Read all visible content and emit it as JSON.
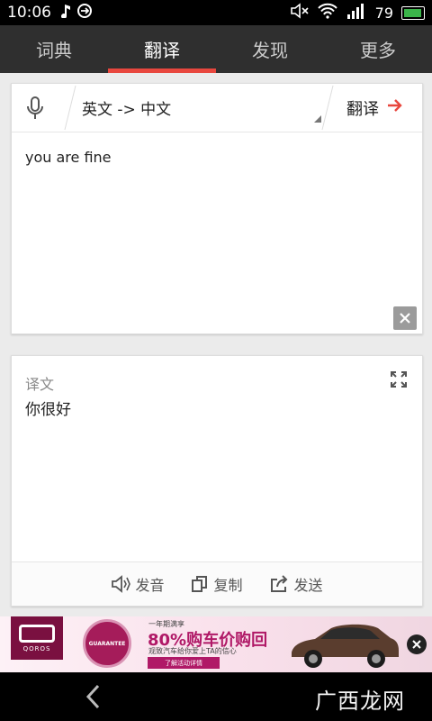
{
  "status_bar": {
    "time": "10:06",
    "battery_level": "79"
  },
  "tabs": [
    {
      "label": "词典",
      "active": false
    },
    {
      "label": "翻译",
      "active": true
    },
    {
      "label": "发现",
      "active": false
    },
    {
      "label": "更多",
      "active": false
    }
  ],
  "translator": {
    "language_pair": "英文 -> 中文",
    "translate_label": "翻译",
    "input_text": "you are fine",
    "result_label": "译文",
    "result_text": "你很好"
  },
  "actions": {
    "speak": "发音",
    "copy": "复制",
    "send": "发送"
  },
  "ad": {
    "brand": "QOROS",
    "badge": "GUARANTEE",
    "line1": "一年期满享",
    "line2": "80%购车价购回",
    "line3": "观致汽车给你爱上TA的信心",
    "cta": "了解活动详情"
  },
  "watermark": "广西龙网",
  "colors": {
    "accent": "#e8473e",
    "tab_bar": "#2f2f2f",
    "ad_brand": "#b01967"
  }
}
